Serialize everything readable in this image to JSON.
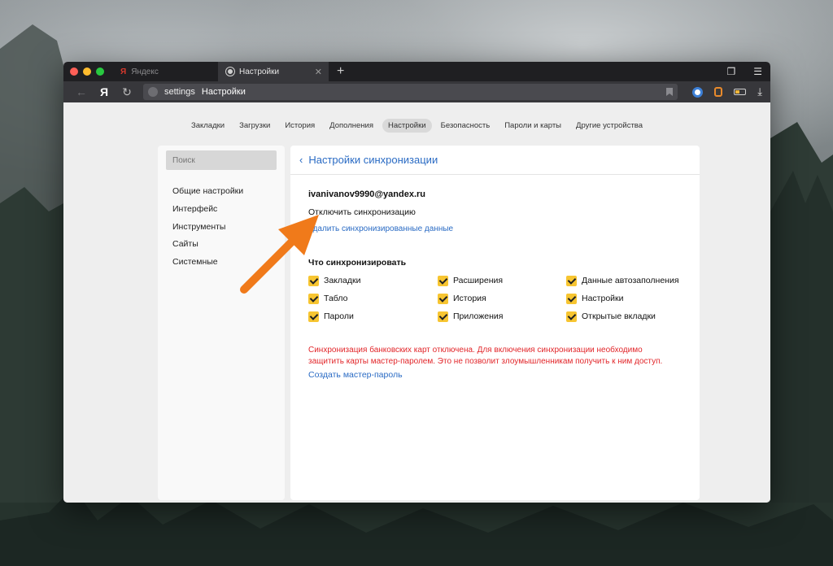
{
  "tabs": [
    {
      "label": "Яндекс",
      "active": false
    },
    {
      "label": "Настройки",
      "active": true
    }
  ],
  "address": {
    "url": "settings",
    "title": "Настройки",
    "ya_label": "Я"
  },
  "top_nav": [
    {
      "label": "Закладки",
      "active": false
    },
    {
      "label": "Загрузки",
      "active": false
    },
    {
      "label": "История",
      "active": false
    },
    {
      "label": "Дополнения",
      "active": false
    },
    {
      "label": "Настройки",
      "active": true
    },
    {
      "label": "Безопасность",
      "active": false
    },
    {
      "label": "Пароли и карты",
      "active": false
    },
    {
      "label": "Другие устройства",
      "active": false
    }
  ],
  "sidebar": {
    "search_placeholder": "Поиск",
    "items": [
      {
        "label": "Общие настройки"
      },
      {
        "label": "Интерфейс"
      },
      {
        "label": "Инструменты"
      },
      {
        "label": "Сайты"
      },
      {
        "label": "Системные"
      }
    ]
  },
  "main": {
    "title": "Настройки синхронизации",
    "email": "ivanivanov9990@yandex.ru",
    "disable_sync": "Отключить синхронизацию",
    "delete_synced": "Удалить синхронизированные данные",
    "what_to_sync": "Что синхронизировать",
    "sync_items": [
      {
        "label": "Закладки",
        "checked": true
      },
      {
        "label": "Расширения",
        "checked": true
      },
      {
        "label": "Данные автозаполнения",
        "checked": true
      },
      {
        "label": "Табло",
        "checked": true
      },
      {
        "label": "История",
        "checked": true
      },
      {
        "label": "Настройки",
        "checked": true
      },
      {
        "label": "Пароли",
        "checked": true
      },
      {
        "label": "Приложения",
        "checked": true
      },
      {
        "label": "Открытые вкладки",
        "checked": true
      }
    ],
    "warning": "Синхронизация банковских карт отключена. Для включения синхронизации необходимо защитить карты мастер-паролем. Это не позволит злоумышленникам получить к ним доступ.",
    "create_master_password": "Создать мастер-пароль"
  },
  "colors": {
    "accent_link": "#2a6bc4",
    "checkbox": "#f7c531",
    "warning": "#e2262a",
    "annotation_arrow": "#f07a1a"
  }
}
